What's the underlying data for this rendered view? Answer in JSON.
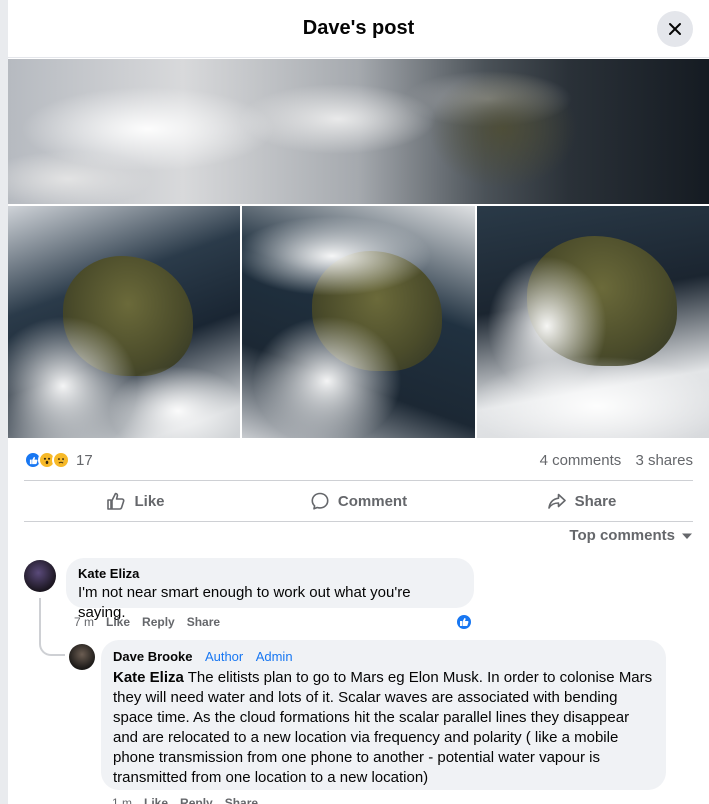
{
  "header": {
    "title": "Dave's post"
  },
  "icons": {
    "close": "close-icon",
    "like": "thumbs-up-icon",
    "comment": "comment-bubble-icon",
    "share": "share-arrow-icon",
    "sort": "chevron-down-icon"
  },
  "colors": {
    "accent": "#1877f2",
    "muted": "#65676b",
    "bubble": "#f0f2f5"
  },
  "stats": {
    "reaction_count": "17",
    "comments": "4 comments",
    "shares": "3 shares"
  },
  "actions": {
    "like": "Like",
    "comment": "Comment",
    "share": "Share"
  },
  "sort": {
    "label": "Top comments"
  },
  "comments": [
    {
      "author": "Kate Eliza",
      "text": "I'm not near smart enough to work out what you're saying.",
      "time": "7 m",
      "like": "Like",
      "reply": "Reply",
      "share": "Share"
    }
  ],
  "reply": {
    "author": "Dave Brooke",
    "tag_author": "Author",
    "tag_admin": "Admin",
    "mention": "Kate Eliza",
    "text": " The elitists plan to go to Mars eg Elon Musk. In order to colonise Mars they will need water and lots of it. Scalar waves are associated with bending space time. As the cloud formations hit the scalar parallel lines they disappear and are relocated to a new location via frequency and polarity ( like a mobile phone transmission from one phone to another - potential water vapour is transmitted from one location to a new location)",
    "time": "1 m",
    "like": "Like",
    "reply": "Reply",
    "share": "Share"
  }
}
